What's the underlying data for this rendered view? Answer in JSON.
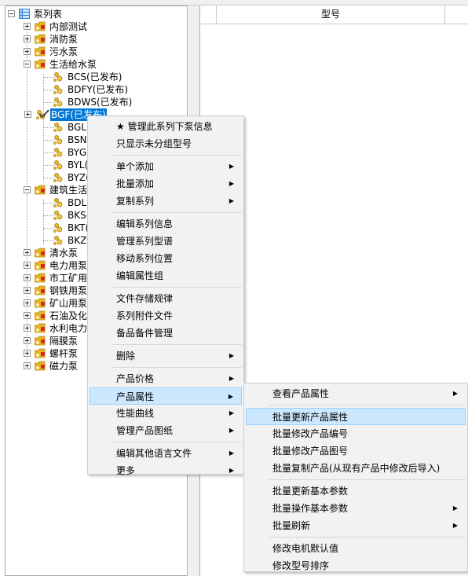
{
  "tree": {
    "root": {
      "label": "泵列表"
    },
    "top_nodes": [
      {
        "label": "内部测试"
      },
      {
        "label": "消防泵"
      },
      {
        "label": "污水泵"
      },
      {
        "label": "生活给水泵"
      }
    ],
    "shenghuo_children": [
      {
        "label": "BCS(已发布)"
      },
      {
        "label": "BDFY(已发布)"
      },
      {
        "label": "BDWS(已发布)"
      },
      {
        "label": "BGF(已发布)"
      },
      {
        "label": "BGL("
      },
      {
        "label": "BSN("
      },
      {
        "label": "BYG("
      },
      {
        "label": "BYL("
      },
      {
        "label": "BYZ("
      }
    ],
    "jianzhu": {
      "label": "建筑生活"
    },
    "jianzhu_children": [
      {
        "label": "BDLL"
      },
      {
        "label": "BKS("
      },
      {
        "label": "BKT("
      },
      {
        "label": "BKZ("
      }
    ],
    "bottom_nodes": [
      {
        "label": "清水泵"
      },
      {
        "label": "电力用泵"
      },
      {
        "label": "市工矿用"
      },
      {
        "label": "钢铁用泵"
      },
      {
        "label": "矿山用泵"
      },
      {
        "label": "石油及化"
      },
      {
        "label": "水利电力"
      },
      {
        "label": "隔膜泵"
      },
      {
        "label": "螺杆泵"
      },
      {
        "label": "磁力泵"
      }
    ]
  },
  "grid": {
    "column_header": "型号"
  },
  "context_menu": {
    "items": [
      {
        "label": "★ 管理此系列下泵信息",
        "has_submenu": false
      },
      {
        "label": "只显示未分组型号",
        "has_submenu": false
      },
      {
        "label": "单个添加",
        "has_submenu": true
      },
      {
        "label": "批量添加",
        "has_submenu": true
      },
      {
        "label": "复制系列",
        "has_submenu": true
      },
      {
        "label": "编辑系列信息",
        "has_submenu": false
      },
      {
        "label": "管理系列型谱",
        "has_submenu": false
      },
      {
        "label": "移动系列位置",
        "has_submenu": false
      },
      {
        "label": "编辑属性组",
        "has_submenu": false
      },
      {
        "label": "文件存储规律",
        "has_submenu": false
      },
      {
        "label": "系列附件文件",
        "has_submenu": false
      },
      {
        "label": "备品备件管理",
        "has_submenu": false
      },
      {
        "label": "删除",
        "has_submenu": true
      },
      {
        "label": "产品价格",
        "has_submenu": true
      },
      {
        "label": "产品属性",
        "has_submenu": true,
        "highlighted": true
      },
      {
        "label": "性能曲线",
        "has_submenu": true
      },
      {
        "label": "管理产品图纸",
        "has_submenu": true
      },
      {
        "label": "编辑其他语言文件",
        "has_submenu": true
      },
      {
        "label": "更多",
        "has_submenu": true
      }
    ]
  },
  "submenu": {
    "items": [
      {
        "label": "查看产品属性",
        "has_submenu": true
      },
      {
        "label": "批量更新产品属性",
        "has_submenu": false,
        "highlighted": true
      },
      {
        "label": "批量修改产品编号",
        "has_submenu": false
      },
      {
        "label": "批量修改产品图号",
        "has_submenu": false
      },
      {
        "label": "批量复制产品(从现有产品中修改后导入)",
        "has_submenu": false
      },
      {
        "label": "批量更新基本参数",
        "has_submenu": false
      },
      {
        "label": "批量操作基本参数",
        "has_submenu": true
      },
      {
        "label": "批量刷新",
        "has_submenu": true
      },
      {
        "label": "修改电机默认值",
        "has_submenu": false
      },
      {
        "label": "修改型号排序",
        "has_submenu": false
      }
    ]
  },
  "icons": {
    "root": "grid-list-icon",
    "folder": "folder-pump-icon",
    "series": "pump-series-icon",
    "checked": "checkmark-icon",
    "submenu_arrow": "submenu-arrow-icon"
  },
  "colors": {
    "selection": "#0078d7",
    "menu_highlight": "#cce8ff",
    "folder": "#e6b422"
  }
}
